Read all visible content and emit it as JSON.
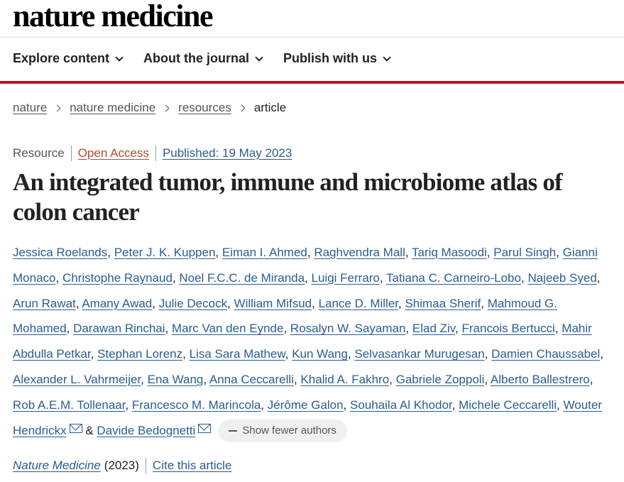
{
  "site": {
    "logo": "nature medicine"
  },
  "nav": [
    {
      "label": "Explore content"
    },
    {
      "label": "About the journal"
    },
    {
      "label": "Publish with us"
    }
  ],
  "breadcrumb": [
    {
      "label": "nature"
    },
    {
      "label": "nature medicine"
    },
    {
      "label": "resources"
    },
    {
      "label": "article"
    }
  ],
  "meta": {
    "type": "Resource",
    "access": "Open Access",
    "published": "Published: 19 May 2023"
  },
  "title": "An integrated tumor, immune and microbiome atlas of colon cancer",
  "authors": [
    "Jessica Roelands",
    "Peter J. K. Kuppen",
    "Eiman I. Ahmed",
    "Raghvendra Mall",
    "Tariq Masoodi",
    "Parul Singh",
    "Gianni Monaco",
    "Christophe Raynaud",
    "Noel F.C.C. de Miranda",
    "Luigi Ferraro",
    "Tatiana C. Carneiro-Lobo",
    "Najeeb Syed",
    "Arun Rawat",
    "Amany Awad",
    "Julie Decock",
    "William Mifsud",
    "Lance D. Miller",
    "Shimaa Sherif",
    "Mahmoud G. Mohamed",
    "Darawan Rinchai",
    "Marc Van den Eynde",
    "Rosalyn W. Sayaman",
    "Elad Ziv",
    "Francois Bertucci",
    "Mahir Abdulla Petkar",
    "Stephan Lorenz",
    "Lisa Sara Mathew",
    "Kun Wang",
    "Selvasankar Murugesan",
    "Damien Chaussabel",
    "Alexander L. Vahrmeijer",
    "Ena Wang",
    "Anna Ceccarelli",
    "Khalid A. Fakhro",
    "Gabriele Zoppoli",
    "Alberto Ballestrero",
    "Rob A.E.M. Tollenaar",
    "Francesco M. Marincola",
    "Jérôme Galon",
    "Souhaila Al Khodor",
    "Michele Ceccarelli",
    "Wouter Hendrickx",
    "Davide Bedognetti"
  ],
  "author_joiner": "&",
  "show_fewer_label": "Show fewer authors",
  "citation": {
    "journal": "Nature Medicine",
    "year": "(2023)",
    "cite_label": "Cite this article"
  }
}
